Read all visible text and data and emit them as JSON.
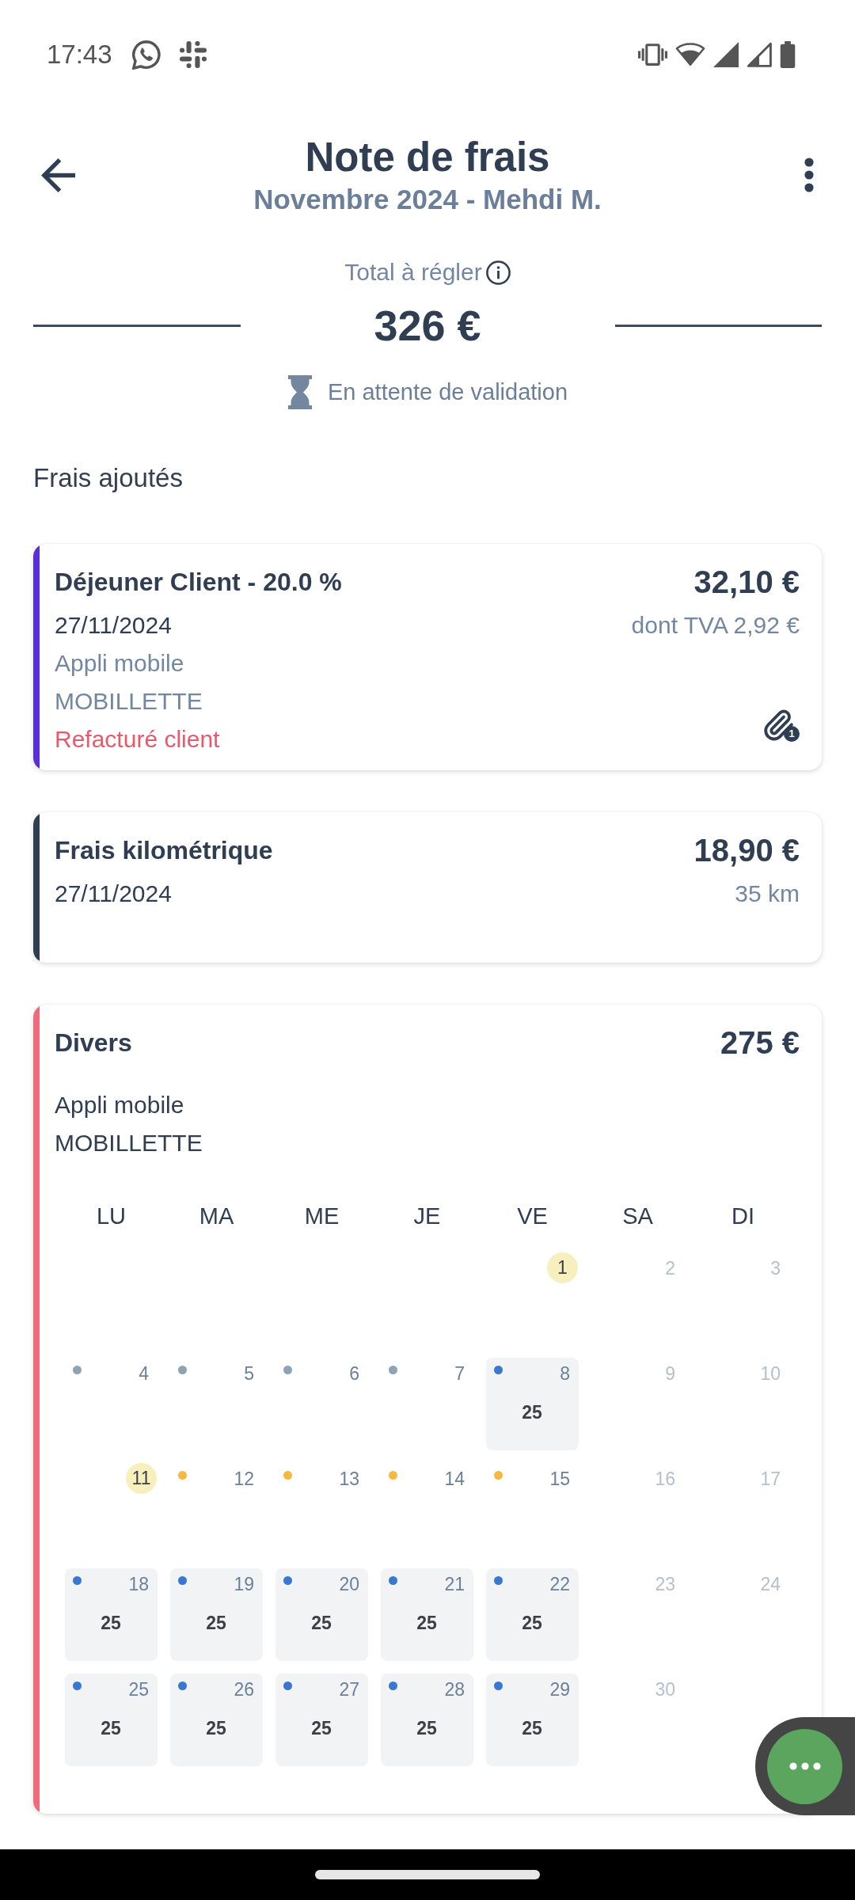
{
  "status_bar": {
    "time": "17:43"
  },
  "header": {
    "title": "Note de frais",
    "subtitle": "Novembre 2024 - Mehdi M."
  },
  "summary": {
    "label": "Total à régler",
    "total": "326 €",
    "status": "En attente de validation"
  },
  "section_title": "Frais ajoutés",
  "expenses": [
    {
      "kind": "expense",
      "color": "#5b2fd8",
      "title": "Déjeuner Client - 20.0 %",
      "amount": "32,10 €",
      "date": "27/11/2024",
      "detail": "dont TVA 2,92 €",
      "lines": [
        "Appli mobile",
        "MOBILLETTE"
      ],
      "note": "Refacturé client",
      "attachments": "1"
    },
    {
      "kind": "mileage",
      "color": "#2f3e52",
      "title": "Frais kilométrique",
      "amount": "18,90 €",
      "date": "27/11/2024",
      "detail": "35 km"
    },
    {
      "kind": "grouped",
      "color": "#ef6b7a",
      "title": "Divers",
      "amount": "275 €",
      "lines": [
        "Appli mobile",
        "MOBILLETTE"
      ],
      "calendar": {
        "weekdays": [
          "LU",
          "MA",
          "ME",
          "JE",
          "VE",
          "SA",
          "DI"
        ],
        "weeks": [
          {
            "flush_right": true,
            "days": [
              {
                "day": "1",
                "weekend": false,
                "holiday": true
              },
              {
                "day": "2",
                "weekend": true,
                "holiday": false
              },
              {
                "day": "3",
                "weekend": true,
                "holiday": false
              }
            ]
          },
          {
            "days": [
              {
                "day": "4",
                "weekend": false,
                "holiday": false,
                "color": "#8ea3b6"
              },
              {
                "day": "5",
                "weekend": false,
                "holiday": false,
                "color": "#8ea3b6"
              },
              {
                "day": "6",
                "weekend": false,
                "holiday": false,
                "color": "#8ea3b6"
              },
              {
                "day": "7",
                "weekend": false,
                "holiday": false,
                "color": "#8ea3b6"
              },
              {
                "day": "8",
                "weekend": false,
                "holiday": false,
                "color": "#3a78d0",
                "amount": "25"
              },
              {
                "day": "9",
                "weekend": true,
                "holiday": false
              },
              {
                "day": "10",
                "weekend": true,
                "holiday": false
              }
            ]
          },
          {
            "days": [
              {
                "day": "11",
                "weekend": false,
                "holiday": true
              },
              {
                "day": "12",
                "weekend": false,
                "holiday": false,
                "color": "#f5b940"
              },
              {
                "day": "13",
                "weekend": false,
                "holiday": false,
                "color": "#f5b940"
              },
              {
                "day": "14",
                "weekend": false,
                "holiday": false,
                "color": "#f5b940"
              },
              {
                "day": "15",
                "weekend": false,
                "holiday": false,
                "color": "#f5b940"
              },
              {
                "day": "16",
                "weekend": true,
                "holiday": false
              },
              {
                "day": "17",
                "weekend": true,
                "holiday": false
              }
            ]
          },
          {
            "days": [
              {
                "day": "18",
                "weekend": false,
                "holiday": false,
                "color": "#3a78d0",
                "amount": "25"
              },
              {
                "day": "19",
                "weekend": false,
                "holiday": false,
                "color": "#3a78d0",
                "amount": "25"
              },
              {
                "day": "20",
                "weekend": false,
                "holiday": false,
                "color": "#3a78d0",
                "amount": "25"
              },
              {
                "day": "21",
                "weekend": false,
                "holiday": false,
                "color": "#3a78d0",
                "amount": "25"
              },
              {
                "day": "22",
                "weekend": false,
                "holiday": false,
                "color": "#3a78d0",
                "amount": "25"
              },
              {
                "day": "23",
                "weekend": true,
                "holiday": false
              },
              {
                "day": "24",
                "weekend": true,
                "holiday": false
              }
            ]
          },
          {
            "flush_right": false,
            "days": [
              {
                "day": "25",
                "weekend": false,
                "holiday": false,
                "color": "#3a78d0",
                "amount": "25"
              },
              {
                "day": "26",
                "weekend": false,
                "holiday": false,
                "color": "#3a78d0",
                "amount": "25"
              },
              {
                "day": "27",
                "weekend": false,
                "holiday": false,
                "color": "#3a78d0",
                "amount": "25"
              },
              {
                "day": "28",
                "weekend": false,
                "holiday": false,
                "color": "#3a78d0",
                "amount": "25"
              },
              {
                "day": "29",
                "weekend": false,
                "holiday": false,
                "color": "#3a78d0",
                "amount": "25"
              },
              {
                "day": "30",
                "weekend": true,
                "holiday": false
              }
            ]
          }
        ]
      }
    }
  ]
}
